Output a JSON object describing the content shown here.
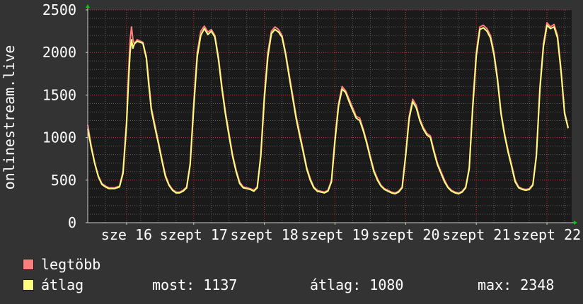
{
  "chart_data": {
    "type": "line",
    "ylabel": "onlinestream.live",
    "ylim": [
      0,
      2500
    ],
    "yticks": [
      0,
      500,
      1000,
      1500,
      2000,
      2500
    ],
    "xlim": [
      0,
      6.85
    ],
    "xtick_positions": [
      0.55,
      1.5,
      2.5,
      3.5,
      4.5,
      5.5,
      6.5
    ],
    "xticks": [
      "sze 16",
      "szept 17",
      "szept 18",
      "szept 19",
      "szept 20",
      "szept 21",
      "szept 22"
    ],
    "grid": true,
    "series": [
      {
        "name": "legtöbb",
        "color": "#ff7f7f",
        "points": [
          [
            0.0,
            1150
          ],
          [
            0.05,
            900
          ],
          [
            0.1,
            700
          ],
          [
            0.15,
            550
          ],
          [
            0.2,
            460
          ],
          [
            0.25,
            430
          ],
          [
            0.3,
            410
          ],
          [
            0.38,
            410
          ],
          [
            0.45,
            430
          ],
          [
            0.5,
            600
          ],
          [
            0.55,
            1200
          ],
          [
            0.58,
            1800
          ],
          [
            0.6,
            2150
          ],
          [
            0.62,
            2300
          ],
          [
            0.64,
            2150
          ],
          [
            0.66,
            2100
          ],
          [
            0.7,
            2150
          ],
          [
            0.78,
            2120
          ],
          [
            0.83,
            1950
          ],
          [
            0.86,
            1700
          ],
          [
            0.9,
            1350
          ],
          [
            0.95,
            1150
          ],
          [
            1.0,
            950
          ],
          [
            1.05,
            750
          ],
          [
            1.1,
            560
          ],
          [
            1.15,
            450
          ],
          [
            1.2,
            390
          ],
          [
            1.25,
            360
          ],
          [
            1.3,
            360
          ],
          [
            1.35,
            380
          ],
          [
            1.4,
            420
          ],
          [
            1.45,
            700
          ],
          [
            1.5,
            1400
          ],
          [
            1.55,
            2000
          ],
          [
            1.6,
            2250
          ],
          [
            1.65,
            2310
          ],
          [
            1.7,
            2240
          ],
          [
            1.75,
            2270
          ],
          [
            1.8,
            2200
          ],
          [
            1.85,
            1950
          ],
          [
            1.9,
            1600
          ],
          [
            1.95,
            1300
          ],
          [
            2.0,
            1050
          ],
          [
            2.05,
            800
          ],
          [
            2.1,
            620
          ],
          [
            2.15,
            480
          ],
          [
            2.2,
            420
          ],
          [
            2.25,
            410
          ],
          [
            2.3,
            400
          ],
          [
            2.35,
            380
          ],
          [
            2.4,
            420
          ],
          [
            2.45,
            800
          ],
          [
            2.5,
            1500
          ],
          [
            2.55,
            2000
          ],
          [
            2.6,
            2250
          ],
          [
            2.65,
            2300
          ],
          [
            2.7,
            2270
          ],
          [
            2.75,
            2200
          ],
          [
            2.8,
            2000
          ],
          [
            2.85,
            1750
          ],
          [
            2.9,
            1500
          ],
          [
            2.95,
            1250
          ],
          [
            3.0,
            1050
          ],
          [
            3.05,
            850
          ],
          [
            3.1,
            650
          ],
          [
            3.15,
            520
          ],
          [
            3.2,
            420
          ],
          [
            3.25,
            380
          ],
          [
            3.3,
            370
          ],
          [
            3.35,
            360
          ],
          [
            3.4,
            380
          ],
          [
            3.45,
            500
          ],
          [
            3.5,
            1000
          ],
          [
            3.55,
            1400
          ],
          [
            3.6,
            1600
          ],
          [
            3.65,
            1550
          ],
          [
            3.7,
            1450
          ],
          [
            3.75,
            1350
          ],
          [
            3.8,
            1250
          ],
          [
            3.85,
            1230
          ],
          [
            3.9,
            1100
          ],
          [
            3.95,
            950
          ],
          [
            4.0,
            780
          ],
          [
            4.05,
            620
          ],
          [
            4.1,
            520
          ],
          [
            4.15,
            440
          ],
          [
            4.2,
            400
          ],
          [
            4.25,
            380
          ],
          [
            4.3,
            360
          ],
          [
            4.35,
            350
          ],
          [
            4.4,
            370
          ],
          [
            4.45,
            420
          ],
          [
            4.5,
            800
          ],
          [
            4.55,
            1250
          ],
          [
            4.6,
            1450
          ],
          [
            4.65,
            1380
          ],
          [
            4.7,
            1220
          ],
          [
            4.75,
            1120
          ],
          [
            4.8,
            1050
          ],
          [
            4.85,
            1020
          ],
          [
            4.9,
            850
          ],
          [
            4.95,
            700
          ],
          [
            5.0,
            600
          ],
          [
            5.05,
            500
          ],
          [
            5.1,
            420
          ],
          [
            5.15,
            380
          ],
          [
            5.2,
            360
          ],
          [
            5.25,
            350
          ],
          [
            5.3,
            370
          ],
          [
            5.35,
            420
          ],
          [
            5.4,
            650
          ],
          [
            5.45,
            1400
          ],
          [
            5.5,
            2000
          ],
          [
            5.55,
            2300
          ],
          [
            5.6,
            2320
          ],
          [
            5.65,
            2280
          ],
          [
            5.7,
            2200
          ],
          [
            5.75,
            2000
          ],
          [
            5.8,
            1700
          ],
          [
            5.85,
            1300
          ],
          [
            5.9,
            1050
          ],
          [
            5.95,
            850
          ],
          [
            6.0,
            680
          ],
          [
            6.05,
            500
          ],
          [
            6.1,
            420
          ],
          [
            6.15,
            400
          ],
          [
            6.2,
            390
          ],
          [
            6.25,
            400
          ],
          [
            6.3,
            450
          ],
          [
            6.35,
            800
          ],
          [
            6.4,
            1600
          ],
          [
            6.45,
            2100
          ],
          [
            6.5,
            2350
          ],
          [
            6.55,
            2300
          ],
          [
            6.6,
            2330
          ],
          [
            6.65,
            2200
          ],
          [
            6.7,
            1800
          ],
          [
            6.75,
            1300
          ],
          [
            6.8,
            1120
          ]
        ]
      },
      {
        "name": "átlag",
        "color": "#ffff80",
        "points": [
          [
            0.0,
            1100
          ],
          [
            0.05,
            880
          ],
          [
            0.1,
            690
          ],
          [
            0.15,
            540
          ],
          [
            0.2,
            450
          ],
          [
            0.25,
            420
          ],
          [
            0.3,
            400
          ],
          [
            0.38,
            400
          ],
          [
            0.45,
            420
          ],
          [
            0.5,
            580
          ],
          [
            0.55,
            1150
          ],
          [
            0.58,
            1700
          ],
          [
            0.6,
            2000
          ],
          [
            0.62,
            2150
          ],
          [
            0.64,
            2050
          ],
          [
            0.66,
            2100
          ],
          [
            0.7,
            2130
          ],
          [
            0.78,
            2110
          ],
          [
            0.83,
            1930
          ],
          [
            0.86,
            1650
          ],
          [
            0.9,
            1320
          ],
          [
            0.95,
            1120
          ],
          [
            1.0,
            930
          ],
          [
            1.05,
            730
          ],
          [
            1.1,
            540
          ],
          [
            1.15,
            440
          ],
          [
            1.2,
            380
          ],
          [
            1.25,
            350
          ],
          [
            1.3,
            350
          ],
          [
            1.35,
            370
          ],
          [
            1.4,
            410
          ],
          [
            1.45,
            680
          ],
          [
            1.5,
            1350
          ],
          [
            1.55,
            1950
          ],
          [
            1.6,
            2200
          ],
          [
            1.65,
            2280
          ],
          [
            1.7,
            2210
          ],
          [
            1.75,
            2250
          ],
          [
            1.8,
            2180
          ],
          [
            1.85,
            1920
          ],
          [
            1.9,
            1570
          ],
          [
            1.95,
            1270
          ],
          [
            2.0,
            1020
          ],
          [
            2.05,
            780
          ],
          [
            2.1,
            600
          ],
          [
            2.15,
            460
          ],
          [
            2.2,
            410
          ],
          [
            2.25,
            400
          ],
          [
            2.3,
            390
          ],
          [
            2.35,
            370
          ],
          [
            2.4,
            410
          ],
          [
            2.45,
            780
          ],
          [
            2.5,
            1450
          ],
          [
            2.55,
            1950
          ],
          [
            2.6,
            2220
          ],
          [
            2.65,
            2270
          ],
          [
            2.7,
            2240
          ],
          [
            2.75,
            2180
          ],
          [
            2.8,
            1980
          ],
          [
            2.85,
            1720
          ],
          [
            2.9,
            1470
          ],
          [
            2.95,
            1220
          ],
          [
            3.0,
            1020
          ],
          [
            3.05,
            830
          ],
          [
            3.1,
            630
          ],
          [
            3.15,
            500
          ],
          [
            3.2,
            410
          ],
          [
            3.25,
            370
          ],
          [
            3.3,
            360
          ],
          [
            3.35,
            350
          ],
          [
            3.4,
            370
          ],
          [
            3.45,
            480
          ],
          [
            3.5,
            960
          ],
          [
            3.55,
            1370
          ],
          [
            3.6,
            1570
          ],
          [
            3.65,
            1530
          ],
          [
            3.7,
            1420
          ],
          [
            3.75,
            1320
          ],
          [
            3.8,
            1230
          ],
          [
            3.85,
            1200
          ],
          [
            3.9,
            1080
          ],
          [
            3.95,
            930
          ],
          [
            4.0,
            760
          ],
          [
            4.05,
            600
          ],
          [
            4.1,
            500
          ],
          [
            4.15,
            430
          ],
          [
            4.2,
            390
          ],
          [
            4.25,
            370
          ],
          [
            4.3,
            350
          ],
          [
            4.35,
            340
          ],
          [
            4.4,
            360
          ],
          [
            4.45,
            410
          ],
          [
            4.5,
            780
          ],
          [
            4.55,
            1220
          ],
          [
            4.6,
            1420
          ],
          [
            4.65,
            1350
          ],
          [
            4.7,
            1200
          ],
          [
            4.75,
            1100
          ],
          [
            4.8,
            1030
          ],
          [
            4.85,
            1000
          ],
          [
            4.9,
            830
          ],
          [
            4.95,
            680
          ],
          [
            5.0,
            580
          ],
          [
            5.05,
            480
          ],
          [
            5.1,
            410
          ],
          [
            5.15,
            370
          ],
          [
            5.2,
            350
          ],
          [
            5.25,
            340
          ],
          [
            5.3,
            360
          ],
          [
            5.35,
            410
          ],
          [
            5.4,
            630
          ],
          [
            5.45,
            1350
          ],
          [
            5.5,
            1960
          ],
          [
            5.55,
            2270
          ],
          [
            5.6,
            2290
          ],
          [
            5.65,
            2250
          ],
          [
            5.7,
            2170
          ],
          [
            5.75,
            1970
          ],
          [
            5.8,
            1670
          ],
          [
            5.85,
            1280
          ],
          [
            5.9,
            1030
          ],
          [
            5.95,
            830
          ],
          [
            6.0,
            660
          ],
          [
            6.05,
            480
          ],
          [
            6.1,
            410
          ],
          [
            6.15,
            390
          ],
          [
            6.2,
            380
          ],
          [
            6.25,
            390
          ],
          [
            6.3,
            440
          ],
          [
            6.35,
            780
          ],
          [
            6.4,
            1560
          ],
          [
            6.45,
            2070
          ],
          [
            6.5,
            2320
          ],
          [
            6.55,
            2280
          ],
          [
            6.6,
            2300
          ],
          [
            6.65,
            2170
          ],
          [
            6.7,
            1770
          ],
          [
            6.75,
            1280
          ],
          [
            6.8,
            1110
          ]
        ]
      }
    ],
    "legend_placement": "bottom-left"
  },
  "legend": {
    "items": [
      {
        "label": "legtöbb",
        "color": "#ff7f7f"
      },
      {
        "label": "átlag",
        "color": "#ffff80"
      }
    ],
    "stats": {
      "now": "most: 1137",
      "avg": "átlag: 1080",
      "max": "max: 2348"
    }
  },
  "colors": {
    "background": "#333333",
    "plot_background": "#1a1a1a",
    "grid_minor": "#5a5a5a",
    "grid_major": "#cc3333",
    "axis_arrow": "#00cc00"
  }
}
